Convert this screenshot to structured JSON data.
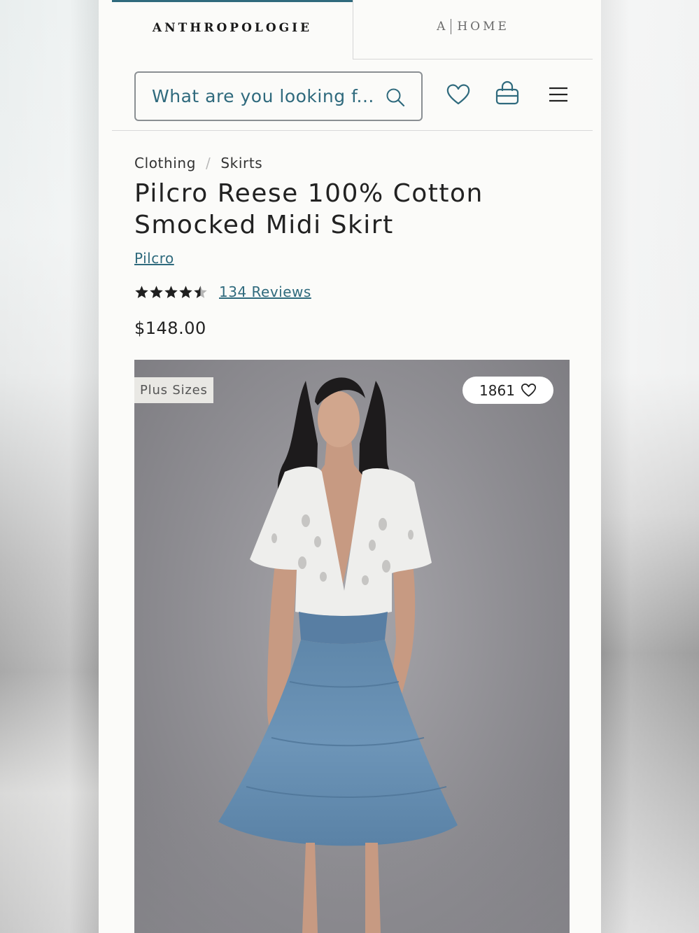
{
  "brand_tabs": [
    {
      "label": "ANTHROPOLOGIE",
      "active": true
    },
    {
      "label_a": "A",
      "label_home": "HOME",
      "active": false
    }
  ],
  "search": {
    "placeholder": "What are you looking f..."
  },
  "header_icons": [
    "heart-icon",
    "shopping-bag-icon",
    "hamburger-menu-icon"
  ],
  "breadcrumb": [
    "Clothing",
    "Skirts"
  ],
  "breadcrumb_separator": "/",
  "product": {
    "title_line1": "Pilcro Reese 100% Cotton",
    "title_line2": "Smocked Midi Skirt",
    "brand": "Pilcro",
    "rating": 4.5,
    "rating_max": 5,
    "reviews_label": "134 Reviews",
    "price": "$148.00"
  },
  "image": {
    "badge": "Plus Sizes",
    "favorites_count": "1861"
  },
  "colors": {
    "accent": "#2f6a7d",
    "page_bg": "#fbfbf9",
    "text": "#222222"
  }
}
